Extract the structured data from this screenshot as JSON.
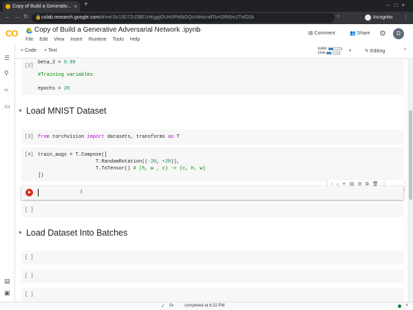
{
  "browser": {
    "tab_title": "Copy of Build a Generativ...",
    "tab_close": "×",
    "new_tab": "+",
    "window_controls": "–□×",
    "nav": "←→↻",
    "url_host": "colab.research.google.com",
    "url_path": "/drive/1lc13D7ZrZ9lE1HKgpjOUH0PWbGQsVt#scrollTo=ORt5m1TvlOSk",
    "incognito_label": "Incognito",
    "menu_dots": "⋮"
  },
  "colab": {
    "logo": "CO",
    "title": "Copy of Build a Generative Adversarial Network .ipynb",
    "star": "☆",
    "menu": [
      "File",
      "Edit",
      "View",
      "Insert",
      "Runtime",
      "Tools",
      "Help"
    ],
    "comment_label": "Comment",
    "share_label": "Share",
    "avatar_initial": "D"
  },
  "toolbar": {
    "add_code": "+ Code",
    "add_text": "+ Text",
    "ram_label": "RAM",
    "disk_label": "Disk",
    "editing_label": "Editing",
    "colors": {
      "accent": "#1a73e8",
      "run": "#d93025",
      "ok": "#188038"
    }
  },
  "cells": {
    "c2": {
      "prompt": "[2]",
      "line1a": "beta_2 = ",
      "line1b": "0.99",
      "comment": "#Training variables",
      "line3a": "epochs = ",
      "line3b": "20"
    },
    "section1": "Load MNIST Dataset",
    "c3": {
      "prompt": "[3]",
      "kw_from": "from",
      "mod": " torchvision ",
      "kw_import": "import",
      "names": " datasets, transforms ",
      "kw_as": "as",
      "alias": " T"
    },
    "c4": {
      "prompt": "[4]",
      "l1": "train_augs = T.Compose([",
      "l2a": "                    T.RandomRotation((",
      "l2b": "-20",
      "l2c": ", ",
      "l2d": "+20",
      "l2e": ")),",
      "l3a": "                    T.ToTensor() ",
      "l3b": "# (h, w , c) -> (c, h, w)",
      "l4": "])"
    },
    "empty_prompt": "[ ]",
    "section2": "Load Dataset Into Batches",
    "cell_toolbar": "↑↓⚭▤⚙⧉🗑⋮"
  },
  "status": {
    "check": "✓",
    "elapsed": "0s",
    "completed": "completed at 6:32 PM",
    "close": "×"
  }
}
